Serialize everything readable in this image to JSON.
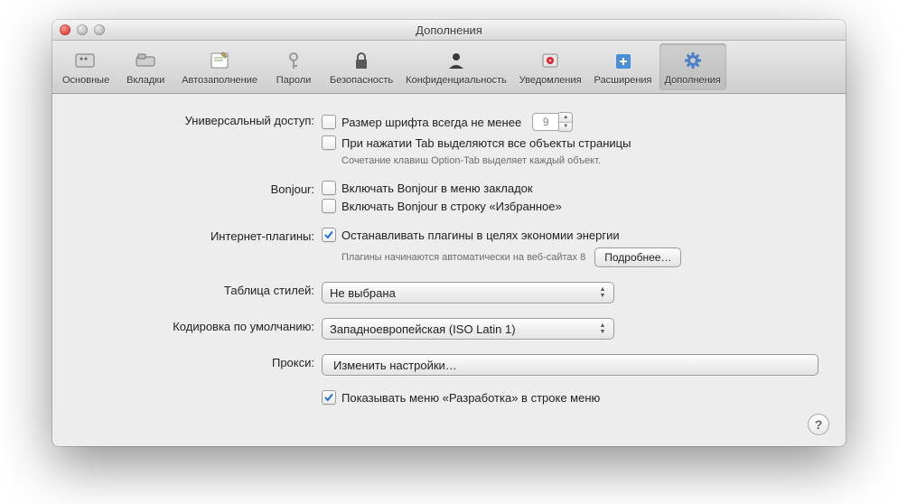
{
  "window": {
    "title": "Дополнения"
  },
  "toolbar": {
    "items": [
      {
        "id": "general",
        "label": "Основные"
      },
      {
        "id": "tabs",
        "label": "Вкладки"
      },
      {
        "id": "autofill",
        "label": "Автозаполнение"
      },
      {
        "id": "passwords",
        "label": "Пароли"
      },
      {
        "id": "security",
        "label": "Безопасность"
      },
      {
        "id": "privacy",
        "label": "Конфиденциальность"
      },
      {
        "id": "notifications",
        "label": "Уведомления"
      },
      {
        "id": "extensions",
        "label": "Расширения"
      },
      {
        "id": "advanced",
        "label": "Дополнения"
      }
    ],
    "selected": "advanced"
  },
  "universal_access": {
    "label": "Универсальный доступ:",
    "font_size_checkbox": {
      "checked": false,
      "label": "Размер шрифта всегда не менее",
      "value": "9"
    },
    "tab_highlight_checkbox": {
      "checked": false,
      "label": "При нажатии Tab выделяются все объекты страницы"
    },
    "note": "Сочетание клавиш Option-Tab выделяет каждый объект."
  },
  "bonjour": {
    "label": "Bonjour:",
    "bookmarks_checkbox": {
      "checked": false,
      "label": "Включать Bonjour в меню закладок"
    },
    "favorites_checkbox": {
      "checked": false,
      "label": "Включать Bonjour в строку «Избранное»"
    }
  },
  "plugins": {
    "label": "Интернет-плагины:",
    "power_checkbox": {
      "checked": true,
      "label": "Останавливать плагины в целях экономии энергии"
    },
    "note": "Плагины начинаются автоматически на веб-сайтах 8",
    "more_button": "Подробнее…"
  },
  "stylesheet": {
    "label": "Таблица стилей:",
    "value": "Не выбрана"
  },
  "encoding": {
    "label": "Кодировка по умолчанию:",
    "value": "Западноевропейская (ISO Latin 1)"
  },
  "proxies": {
    "label": "Прокси:",
    "button": "Изменить настройки…"
  },
  "develop_menu": {
    "checked": true,
    "label": "Показывать меню «Разработка» в строке меню"
  },
  "help": "?"
}
